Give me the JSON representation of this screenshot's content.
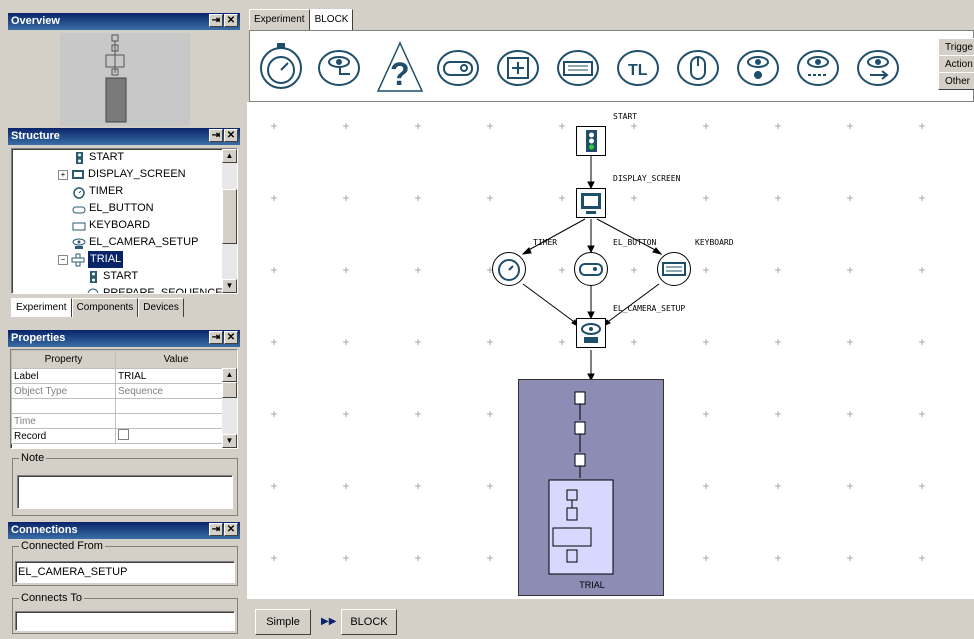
{
  "overview": {
    "title": "Overview",
    "btn_pin": "⇥",
    "btn_close": "✕"
  },
  "structure": {
    "title": "Structure",
    "items": [
      {
        "label": "START",
        "icon": "traffic-light-icon"
      },
      {
        "label": "DISPLAY_SCREEN",
        "icon": "monitor-icon"
      },
      {
        "label": "TIMER",
        "icon": "timer-icon"
      },
      {
        "label": "EL_BUTTON",
        "icon": "gamepad-icon"
      },
      {
        "label": "KEYBOARD",
        "icon": "keyboard-icon"
      },
      {
        "label": "EL_CAMERA_SETUP",
        "icon": "camera-eye-icon"
      },
      {
        "label": "TRIAL",
        "icon": "sequence-icon"
      },
      {
        "label": "START",
        "icon": "traffic-light-icon"
      },
      {
        "label": "PREPARE_SEQUENCE",
        "icon": "prepare-icon"
      }
    ],
    "tabs": [
      "Experiment",
      "Components",
      "Devices"
    ]
  },
  "properties": {
    "title": "Properties",
    "col_property": "Property",
    "col_value": "Value",
    "rows": [
      {
        "name": "Label",
        "value": "TRIAL"
      },
      {
        "name": "Object Type",
        "value": "Sequence"
      },
      {
        "name": "",
        "value": ""
      },
      {
        "name": "Time",
        "value": ""
      },
      {
        "name": "Record",
        "value": ""
      }
    ],
    "note_label": "Note"
  },
  "connections": {
    "title": "Connections",
    "from_label": "Connected From",
    "from_value": "EL_CAMERA_SETUP",
    "to_label": "Connects To",
    "to_value": ""
  },
  "editor": {
    "tabs": [
      "Experiment",
      "BLOCK"
    ],
    "right_tabs": [
      "Trigge",
      "Action",
      "Other"
    ],
    "toolbar": [
      "timer-icon",
      "eye-move-icon",
      "question-triangle-icon",
      "gamepad-icon",
      "cross-box-icon",
      "keyboard-icon",
      "ttl-icon",
      "mouse-icon",
      "eye-dot-icon",
      "eye-dash-icon",
      "eye-arrow-icon"
    ]
  },
  "flow": {
    "start": "START",
    "display": "DISPLAY_SCREEN",
    "timer": "TIMER",
    "button": "EL_BUTTON",
    "keyboard": "KEYBOARD",
    "camera": "EL_CAMERA_SETUP",
    "trial": "TRIAL"
  },
  "bottom": {
    "simple": "Simple",
    "arrow": "▶▶",
    "block": "BLOCK"
  }
}
